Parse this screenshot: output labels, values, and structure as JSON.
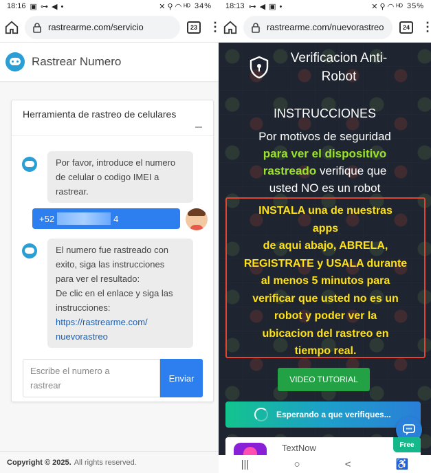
{
  "left": {
    "status": {
      "time": "18:16",
      "icons_left": "▣ ⊶ ◀ •",
      "icons_right": "✕ ⚲ ◠ ᴴᴰ",
      "battery": "34%"
    },
    "url": "rastrearme.com/servicio",
    "tab_count": "23",
    "site_title": "Rastrear Numero",
    "card_title": "Herramienta de rastreo de celulares",
    "bot_msg_1": [
      "Por favor, introduce el numero",
      "de celular o codigo IMEI a",
      "rastrear."
    ],
    "user_msg_prefix": "+52",
    "user_msg_suffix": "4",
    "bot_msg_2": [
      "El numero fue rastreado con",
      "exito, siga las instrucciones",
      "para ver el resultado:",
      "De clic en el enlace y siga las",
      "instrucciones:"
    ],
    "bot_msg_2_link": [
      "https://rastrearme.com/",
      "nuevorastreo"
    ],
    "input_placeholder": [
      "Escribe el numero a",
      "rastrear"
    ],
    "send_label": "Enviar",
    "footer_copyright": "Copyright © 2025.",
    "footer_rights": "All rights reserved."
  },
  "right": {
    "status": {
      "time": "18:13",
      "icons_left": "⊶ ◀ ▣ •",
      "icons_right": "✕ ⚲ ◠ ᴴᴰ",
      "battery": "35%"
    },
    "url": "rastrearme.com/nuevorastreo",
    "tab_count": "24",
    "header_title": [
      "Verificacion Anti-",
      "Robot"
    ],
    "instructions_title": "INSTRUCCIONES",
    "instr_line1": "Por motivos de seguridad",
    "instr_green1": "para ver el dispositivo",
    "instr_green2": "rastreado",
    "instr_line3": "verifique que",
    "instr_line4": "usted NO es un robot",
    "warning_lines": [
      "INSTALA una de nuestras",
      "apps",
      "de aqui abajo, ABRELA,",
      "REGISTRATE y USALA durante",
      "al menos 5 minutos para",
      "verificar que usted no es un",
      "robot y poder ver la",
      "ubicacion del rastreo en",
      "tiempo real."
    ],
    "video_button": "VIDEO TUTORIAL",
    "progress_text": "Esperando a que verifiques...",
    "app_name": "TextNow",
    "free_badge": "Free",
    "nav": [
      "|||",
      "○",
      "<",
      "♿"
    ]
  },
  "colors": {
    "accent_blue": "#2d7ff0",
    "green_btn": "#22a245",
    "warn_yellow": "#ffe11a",
    "warn_border": "#e2452f",
    "green_text": "#9be32a"
  }
}
